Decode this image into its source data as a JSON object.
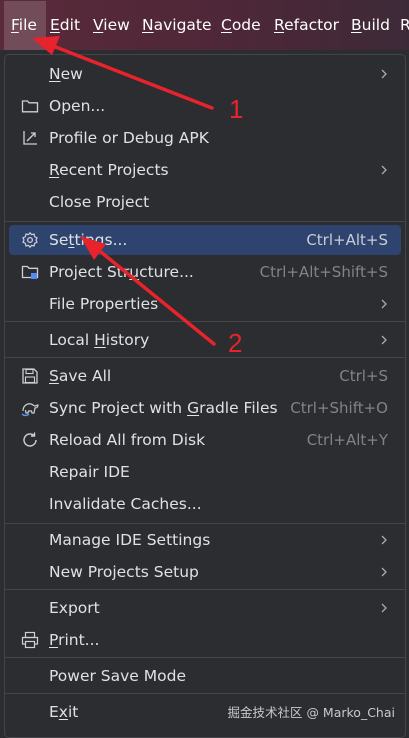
{
  "menubar": {
    "items": [
      {
        "pre": "",
        "u": "F",
        "post": "ile"
      },
      {
        "pre": "",
        "u": "E",
        "post": "dit"
      },
      {
        "pre": "",
        "u": "V",
        "post": "iew"
      },
      {
        "pre": "",
        "u": "N",
        "post": "avigate"
      },
      {
        "pre": "",
        "u": "C",
        "post": "ode"
      },
      {
        "pre": "",
        "u": "R",
        "post": "efactor"
      },
      {
        "pre": "",
        "u": "B",
        "post": "uild"
      },
      {
        "pre": "",
        "u": "R",
        "post": ""
      }
    ]
  },
  "menu": {
    "items": [
      {
        "pre": "",
        "u": "N",
        "post": "ew",
        "shortcut": "",
        "icon": "",
        "submenu": true
      },
      {
        "pre": "Open...",
        "u": "",
        "post": "",
        "shortcut": "",
        "icon": "folder-icon",
        "submenu": false
      },
      {
        "pre": "Profile or Debug APK",
        "u": "",
        "post": "",
        "shortcut": "",
        "icon": "profile-apk-icon",
        "submenu": false
      },
      {
        "pre": "",
        "u": "R",
        "post": "ecent Projects",
        "shortcut": "",
        "icon": "",
        "submenu": true
      },
      {
        "pre": "Close Project",
        "u": "",
        "post": "",
        "shortcut": "",
        "icon": "",
        "submenu": false
      },
      {
        "pre": "Se",
        "u": "t",
        "post": "tings...",
        "shortcut": "Ctrl+Alt+S",
        "icon": "gear-icon",
        "submenu": false
      },
      {
        "pre": "Project Str",
        "u": "u",
        "post": "cture...",
        "shortcut": "Ctrl+Alt+Shift+S",
        "icon": "project-structure-icon",
        "submenu": false
      },
      {
        "pre": "File Properties",
        "u": "",
        "post": "",
        "shortcut": "",
        "icon": "",
        "submenu": true
      },
      {
        "pre": "Local ",
        "u": "H",
        "post": "istory",
        "shortcut": "",
        "icon": "",
        "submenu": true
      },
      {
        "pre": "",
        "u": "S",
        "post": "ave All",
        "shortcut": "Ctrl+S",
        "icon": "save-icon",
        "submenu": false
      },
      {
        "pre": "Sync Project with ",
        "u": "G",
        "post": "radle Files",
        "shortcut": "Ctrl+Shift+O",
        "icon": "gradle-sync-icon",
        "submenu": false
      },
      {
        "pre": "Reload All from Disk",
        "u": "",
        "post": "",
        "shortcut": "Ctrl+Alt+Y",
        "icon": "reload-icon",
        "submenu": false
      },
      {
        "pre": "Repair IDE",
        "u": "",
        "post": "",
        "shortcut": "",
        "icon": "",
        "submenu": false
      },
      {
        "pre": "Invalidate Caches...",
        "u": "",
        "post": "",
        "shortcut": "",
        "icon": "",
        "submenu": false
      },
      {
        "pre": "Manage IDE Settings",
        "u": "",
        "post": "",
        "shortcut": "",
        "icon": "",
        "submenu": true
      },
      {
        "pre": "New Projects Setup",
        "u": "",
        "post": "",
        "shortcut": "",
        "icon": "",
        "submenu": true
      },
      {
        "pre": "Export",
        "u": "",
        "post": "",
        "shortcut": "",
        "icon": "",
        "submenu": true
      },
      {
        "pre": "",
        "u": "P",
        "post": "rint...",
        "shortcut": "",
        "icon": "print-icon",
        "submenu": false
      },
      {
        "pre": "Power Save Mode",
        "u": "",
        "post": "",
        "shortcut": "",
        "icon": "",
        "submenu": false
      },
      {
        "pre": "E",
        "u": "x",
        "post": "it",
        "shortcut": "",
        "icon": "",
        "submenu": false
      }
    ]
  },
  "annotations": {
    "arrow1_label": "1",
    "arrow2_label": "2",
    "arrow_color": "#e8232b"
  },
  "watermark": "掘金技术社区 @ Marko_Chai",
  "colors": {
    "menu_bg": "#2b2d30",
    "selected_bg": "#2e436e",
    "text": "#dfe1e5",
    "shortcut_text": "#80838a"
  }
}
